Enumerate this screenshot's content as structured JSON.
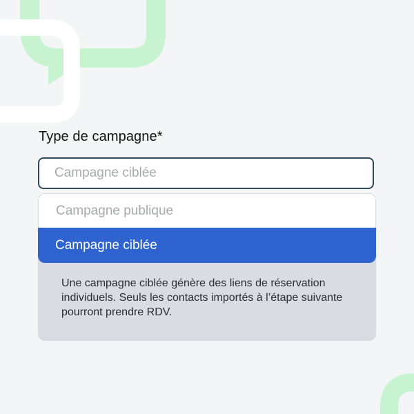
{
  "form": {
    "field_label": "Type de campagne*",
    "select_value": "Campagne ciblée"
  },
  "dropdown": {
    "options": [
      {
        "label": "Campagne publique",
        "selected": false
      },
      {
        "label": "Campagne ciblée",
        "selected": true
      }
    ],
    "help_text": "Une campagne ciblée génère des liens de réservation individuels. Seuls les contacts importés à l’étape suivante pourront prendre RDV."
  },
  "colors": {
    "background": "#f3f5f7",
    "input_border": "#2d4a5d",
    "selected_option_bg": "#2f63d0",
    "dropdown_panel_bg": "#d9dde3",
    "placeholder_text": "#a7a9ad",
    "deco_green": "#c7f3d1",
    "deco_white": "#ffffff"
  }
}
